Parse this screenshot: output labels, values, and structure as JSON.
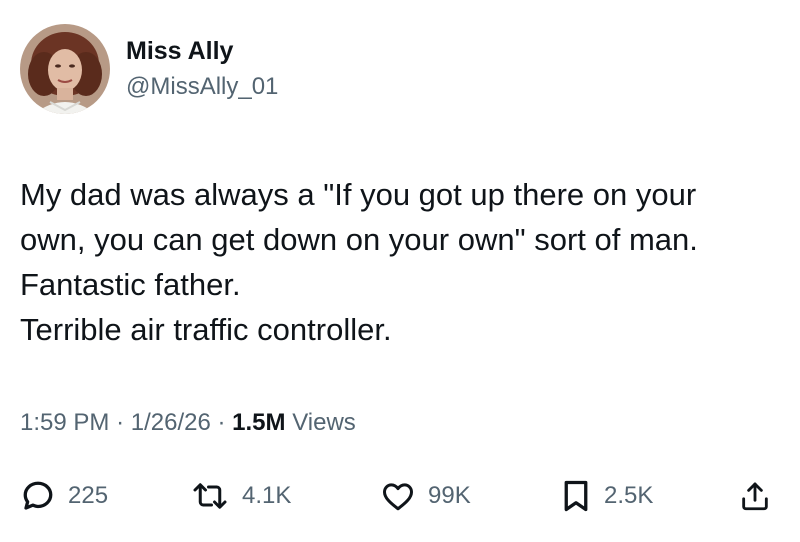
{
  "author": {
    "display_name": "Miss Ally",
    "handle": "@MissAlly_01",
    "avatar_icon": "profile-photo"
  },
  "tweet": {
    "lines": [
      "My dad was always a \"If you got up there on your",
      "own, you can get down on your own\" sort of man.",
      "Fantastic father.",
      "Terrible air traffic controller."
    ]
  },
  "meta": {
    "time": "1:59 PM",
    "separator": "·",
    "date": "1/26/26",
    "views_count": "1.5M",
    "views_label": "Views"
  },
  "actions": {
    "replies": "225",
    "reposts": "4.1K",
    "likes": "99K",
    "bookmarks": "2.5K",
    "reply_icon": "speech-bubble",
    "repost_icon": "retweet-arrows",
    "like_icon": "heart",
    "bookmark_icon": "bookmark",
    "share_icon": "share-upload"
  },
  "colors": {
    "text": "#0f1419",
    "secondary_text": "#536471",
    "background": "#ffffff"
  }
}
